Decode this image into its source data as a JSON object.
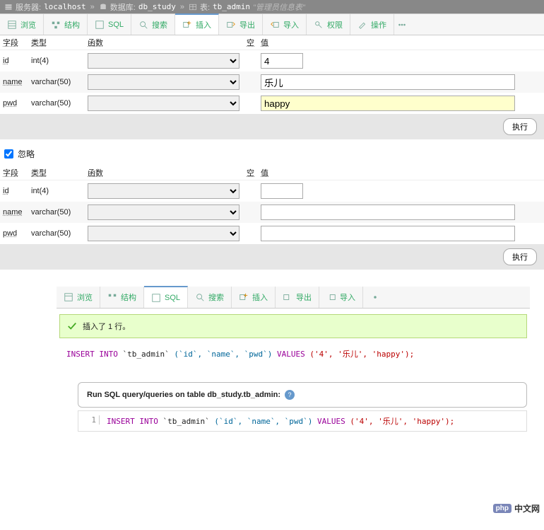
{
  "breadcrumb": {
    "server_label": "服务器:",
    "server_value": "localhost",
    "db_label": "数据库:",
    "db_value": "db_study",
    "table_label": "表:",
    "table_value": "tb_admin",
    "comment": "\"管理员信息表\""
  },
  "tabs": {
    "browse": "浏览",
    "structure": "结构",
    "sql": "SQL",
    "search": "搜索",
    "insert": "插入",
    "export": "导出",
    "import": "导入",
    "privileges": "权限",
    "operations": "操作"
  },
  "headers": {
    "field": "字段",
    "type": "类型",
    "function": "函数",
    "null": "空",
    "value": "值"
  },
  "form1": {
    "rows": [
      {
        "field": "id",
        "type": "int(4)",
        "value": "4",
        "short": true
      },
      {
        "field": "name",
        "type": "varchar(50)",
        "value": "乐儿",
        "short": false
      },
      {
        "field": "pwd",
        "type": "varchar(50)",
        "value": "happy",
        "short": false,
        "hl": true
      }
    ]
  },
  "form2": {
    "rows": [
      {
        "field": "id",
        "type": "int(4)",
        "value": "",
        "short": true
      },
      {
        "field": "name",
        "type": "varchar(50)",
        "value": "",
        "short": false
      },
      {
        "field": "pwd",
        "type": "varchar(50)",
        "value": "",
        "short": false
      }
    ]
  },
  "buttons": {
    "execute": "执行"
  },
  "ignore": {
    "label": "忽略"
  },
  "result": {
    "success_msg": "插入了 1 行。",
    "sql_parts": {
      "kw1": "INSERT INTO",
      "table": "`tb_admin`",
      "cols": "(`id`, `name`, `pwd`)",
      "kw2": "VALUES",
      "vals": "('4', '乐儿', 'happy');"
    },
    "run_label": "Run SQL query/queries on table db_study.tb_admin:",
    "lineno": "1"
  },
  "watermark": "中文网"
}
